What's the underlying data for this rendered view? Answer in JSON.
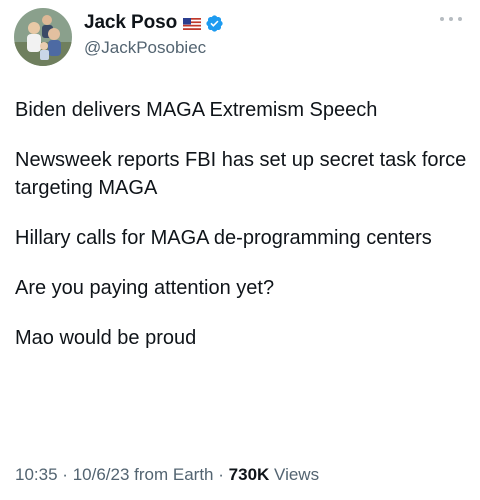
{
  "author": {
    "display_name": "Jack Poso",
    "handle": "@JackPosobiec",
    "flag_icon": "us-flag-icon",
    "verified_icon": "verified-badge-icon"
  },
  "tweet": {
    "paragraphs": [
      "Biden delivers MAGA Extremism Speech",
      "Newsweek reports FBI has set up secret task force targeting MAGA",
      "Hillary calls for MAGA de-programming centers",
      "Are you paying attention yet?",
      "Mao would be proud"
    ]
  },
  "meta": {
    "time": "10:35",
    "date": "10/6/23",
    "source": "from Earth",
    "separator": "·",
    "views_count": "730K",
    "views_label": "Views"
  },
  "colors": {
    "text": "#0f1419",
    "secondary": "#536471",
    "verified": "#1d9bf0"
  }
}
